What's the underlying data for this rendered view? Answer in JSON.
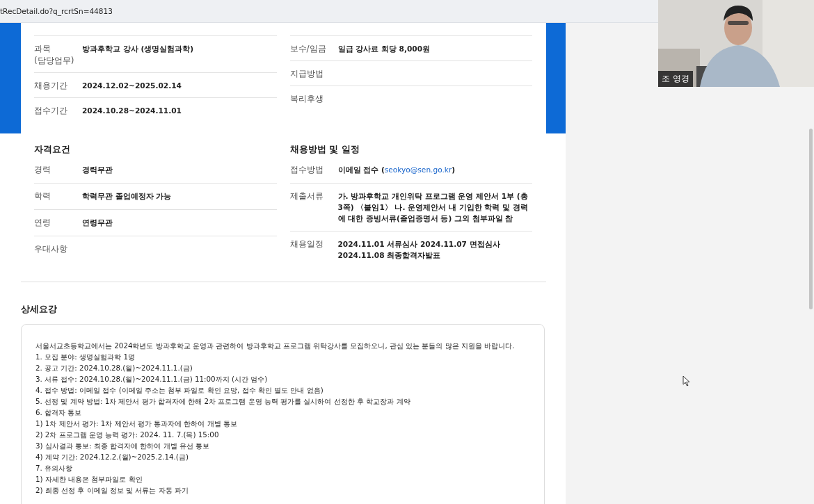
{
  "address_bar": {
    "url": "tRecDetail.do?q_rcrtSn=44813"
  },
  "video_tile": {
    "name": "조 영경"
  },
  "info_left": [
    {
      "label": "과목\n(담당업무)",
      "value": "방과후학교 강사 (생명실험과학)"
    },
    {
      "label": "채용기간",
      "value": "2024.12.02~2025.02.14"
    },
    {
      "label": "접수기간",
      "value": "2024.10.28~2024.11.01"
    }
  ],
  "info_right": [
    {
      "label": "보수/임금",
      "value": "일급 강사료 회당 8,000원"
    },
    {
      "label": "지급방법"
    },
    {
      "label": "복리후생"
    }
  ],
  "qualifications": {
    "title": "자격요건",
    "rows": [
      {
        "label": "경력",
        "value": "경력무관"
      },
      {
        "label": "학력",
        "value": "학력무관 졸업예정자 가능"
      },
      {
        "label": "연령",
        "value": "연령무관"
      },
      {
        "label": "우대사항"
      }
    ]
  },
  "method": {
    "title": "채용방법 및 일정",
    "rows": [
      {
        "label": "접수방법",
        "value": "이메일 접수 (",
        "link": "seokyo@sen.go.kr",
        "suffix": ")"
      },
      {
        "label": "제출서류",
        "value": "가. 방과후학교 개인위탁 프로그램 운영 제안서 1부 (총 3쪽) 〈붙임1〉 나. 운영제안서 내 기입한 학력 및 경력에 대한 증빙서류(졸업증명서 등) 그외 첨부파일 참"
      },
      {
        "label": "채용일정",
        "value": "2024.11.01 서류심사 2024.11.07 면접심사 2024.11.08 최종합격자발표"
      }
    ]
  },
  "details": {
    "title": "상세요강",
    "lines": [
      "서울서교초등학교에서는 2024학년도 방과후학교 운영과 관련하여 방과후학교 프로그램 위탁강사를 모집하오니, 관심 있는 분들의 많은 지원을 바랍니다.",
      "1. 모집 분야: 생명실험과학 1명",
      "2. 공고 기간: 2024.10.28.(월)~2024.11.1.(금)",
      "3. 서류 접수: 2024.10.28.(월)~2024.11.1.(금) 11:00까지 (시간 엄수)",
      "4. 접수 방법: 이메일 접수 (이메일 주소는 첨부 파일로 확인 요망, 접수 확인 별도 안내 없음)",
      "5. 선정 및 계약 방법: 1차 제안서 평가 합격자에 한해 2차 프로그램 운영 능력 평가를 실시하여 선정한 후 학교장과 계약",
      "6. 합격자 통보",
      "1) 1차 제안서 평가: 1차 제안서 평가 통과자에 한하여 개별 통보",
      "2) 2차 프로그램 운영 능력 평가: 2024. 11. 7.(목) 15:00",
      "3) 심사결과 통보: 최종 합격자에 한하여 개별 유선 통보",
      "4) 계약 기간: 2024.12.2.(월)~2025.2.14.(금)",
      "7. 유의사항",
      "1) 자세한 내용은 첨부파일로 확인",
      "2) 최종 선정 후 이메일 정보 및 서류는 자동 파기"
    ]
  }
}
